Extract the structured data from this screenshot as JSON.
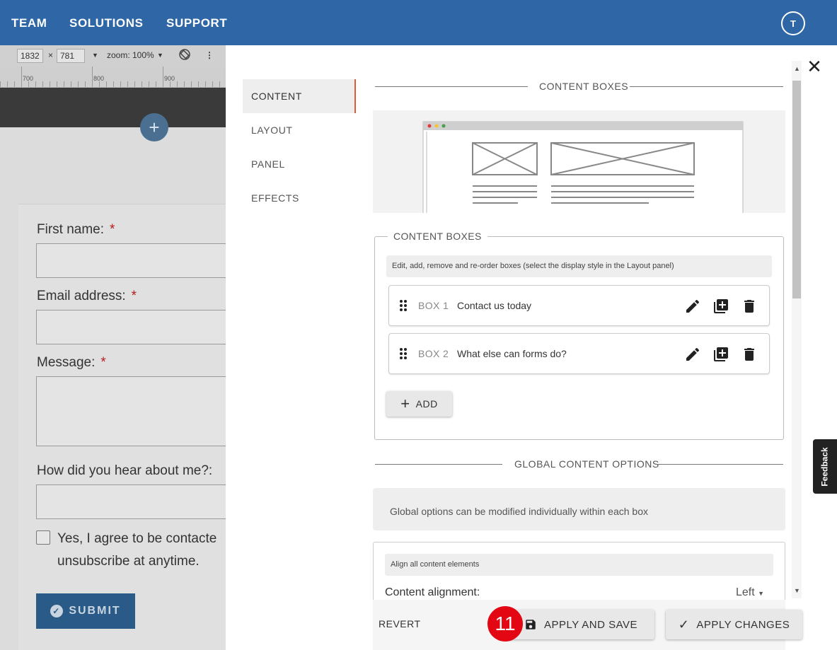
{
  "nav": {
    "items": [
      "TEAM",
      "SOLUTIONS",
      "SUPPORT"
    ],
    "avatar_initial": "T"
  },
  "device_bar": {
    "width": "1832",
    "times": "×",
    "height": "781",
    "zoom": "zoom: 100%",
    "ruler_labels": [
      "700",
      "800",
      "900"
    ]
  },
  "form": {
    "first_name_label": "First name:",
    "email_label": "Email address:",
    "message_label": "Message:",
    "hear_label": "How did you hear about me?:",
    "required_mark": "*",
    "consent_line1": "Yes, I agree to be contacte",
    "consent_line2": "unsubscribe at anytime.",
    "submit_label": "SUBMIT"
  },
  "panel": {
    "tabs": [
      "CONTENT",
      "LAYOUT",
      "PANEL",
      "EFFECTS"
    ],
    "active_tab": "CONTENT",
    "section_content_boxes": "CONTENT BOXES",
    "fieldset_legend": "CONTENT BOXES",
    "fieldset_hint": "Edit, add, remove and re-order boxes (select the display style in the Layout panel)",
    "boxes": [
      {
        "num": "BOX 1",
        "title": "Contact us today"
      },
      {
        "num": "BOX 2",
        "title": "What else can forms do?"
      }
    ],
    "add_label": "ADD",
    "section_global": "GLOBAL CONTENT OPTIONS",
    "global_info": "Global options can be modified individually within each box",
    "align_hint": "Align all content elements",
    "align_label": "Content alignment:",
    "align_value": "Left",
    "revert_label": "REVERT",
    "apply_save_label": "APPLY AND SAVE",
    "apply_changes_label": "APPLY CHANGES",
    "step_badge": "11"
  },
  "feedback_label": "Feedback",
  "colors": {
    "nav_bg": "#2e66a6",
    "active_tab_accent": "#e05a3a",
    "badge_red": "#e30613"
  }
}
